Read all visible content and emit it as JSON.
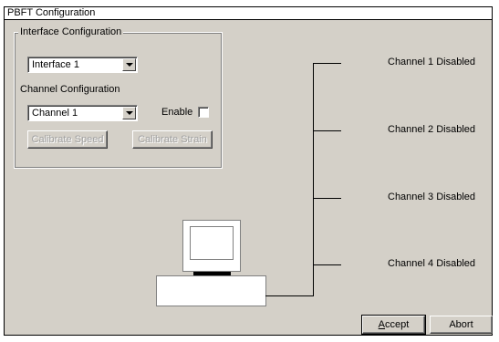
{
  "window": {
    "title": "PBFT Configuration"
  },
  "interface_group": {
    "legend": "Interface Configuration",
    "selected": "Interface 1"
  },
  "channel_group": {
    "legend": "Channel Configuration",
    "selected": "Channel 1",
    "enable_label": "Enable",
    "enable_checked": false,
    "calibrate_speed_label": "Calibrate Speed",
    "calibrate_strain_label": "Calibrate Strain"
  },
  "channels": [
    {
      "label": "Channel 1 Disabled"
    },
    {
      "label": "Channel 2 Disabled"
    },
    {
      "label": "Channel 3 Disabled"
    },
    {
      "label": "Channel 4 Disabled"
    }
  ],
  "buttons": {
    "accept_accel": "A",
    "accept_rest": "ccept",
    "abort": "Abort"
  },
  "icons": [
    "dropdown-arrow-icon",
    "computer-icon",
    "monitor-icon"
  ]
}
